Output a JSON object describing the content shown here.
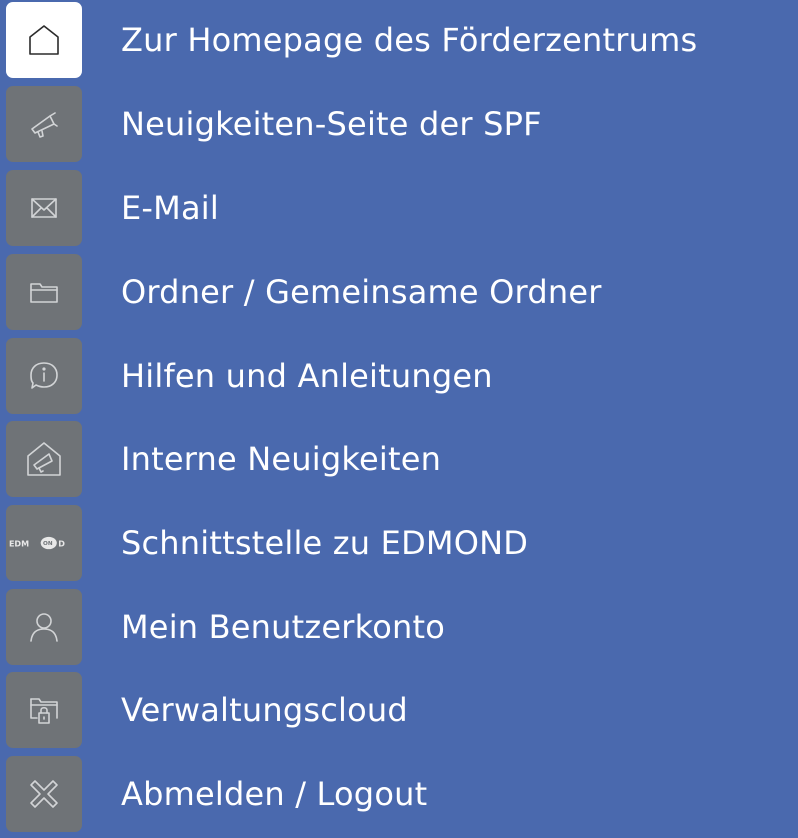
{
  "menu": {
    "items": [
      {
        "label": "Zur Homepage des Förderzentrums",
        "icon": "home-icon",
        "active": true
      },
      {
        "label": "Neuigkeiten-Seite der SPF",
        "icon": "megaphone-icon",
        "active": false
      },
      {
        "label": "E-Mail",
        "icon": "mail-icon",
        "active": false
      },
      {
        "label": "Ordner / Gemeinsame Ordner",
        "icon": "folder-icon",
        "active": false
      },
      {
        "label": "Hilfen und Anleitungen",
        "icon": "info-bubble-icon",
        "active": false
      },
      {
        "label": "Interne Neuigkeiten",
        "icon": "house-megaphone-icon",
        "active": false
      },
      {
        "label": "Schnittstelle zu EDMOND",
        "icon": "edmond-logo-icon",
        "active": false
      },
      {
        "label": "Mein Benutzerkonto",
        "icon": "user-icon",
        "active": false
      },
      {
        "label": "Verwaltungscloud",
        "icon": "locked-folder-icon",
        "active": false
      },
      {
        "label": "Abmelden / Logout",
        "icon": "logout-x-icon",
        "active": false
      }
    ],
    "edmond_logo_text": "EDMOND"
  },
  "colors": {
    "background": "#4a69ae",
    "tile": "#6f7377",
    "tile_active": "#ffffff",
    "text": "#ffffff"
  }
}
